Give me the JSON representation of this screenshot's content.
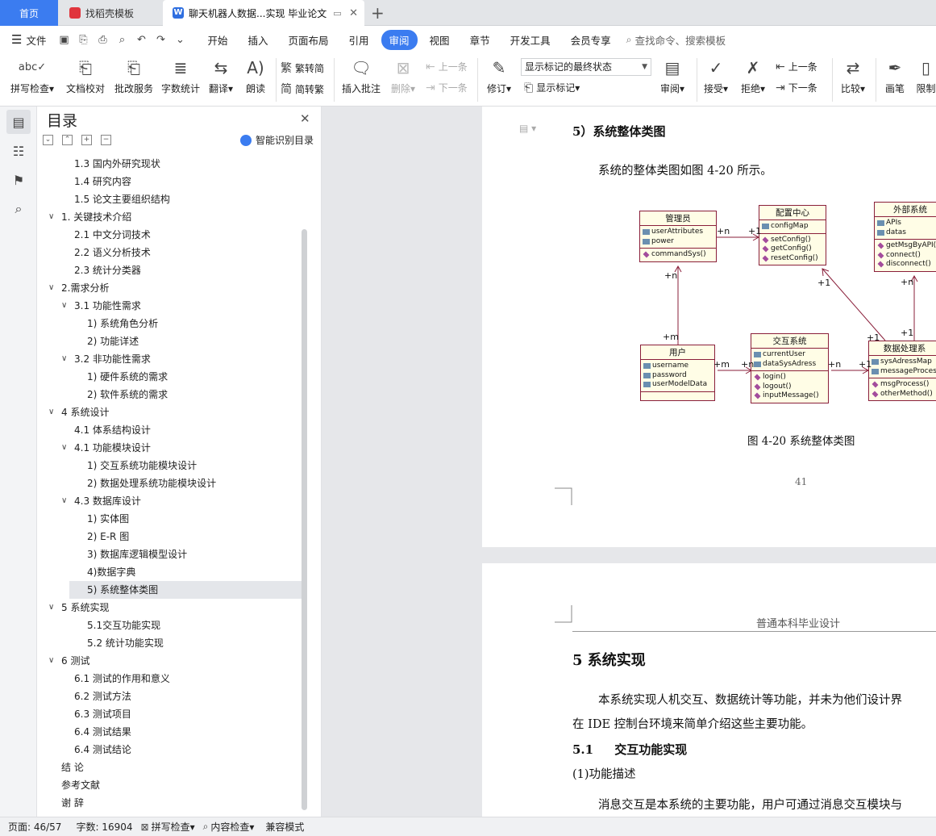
{
  "tabs": {
    "home": "首页",
    "template": "找稻壳模板",
    "document": "聊天机器人数据...实现 毕业论文"
  },
  "menubar": {
    "file": "文件",
    "items": [
      "开始",
      "插入",
      "页面布局",
      "引用",
      "审阅",
      "视图",
      "章节",
      "开发工具",
      "会员专享"
    ],
    "active": "审阅",
    "search": "查找命令、搜索模板"
  },
  "ribbon": {
    "spellcheck": "拼写检查",
    "doc_proof": "文档校对",
    "correction": "批改服务",
    "wordcount": "字数统计",
    "translate": "翻译",
    "read_aloud": "朗读",
    "trad_to_simp": "繁转简",
    "simp_to_trad": "简转繁",
    "insert_comment": "插入批注",
    "delete": "删除",
    "prev_comment": "上一条",
    "next_comment": "下一条",
    "revise": "修订",
    "markup_state": "显示标记的最终状态",
    "show_markup": "显示标记",
    "review": "审阅",
    "accept": "接受",
    "reject": "拒绝",
    "prev_change": "上一条",
    "next_change": "下一条",
    "compare": "比较",
    "pen": "画笔",
    "restrict": "限制"
  },
  "toc": {
    "title": "目录",
    "smart": "智能识别目录",
    "items": [
      {
        "text": "1.3  国内外研究现状",
        "level": 2,
        "arrow": ""
      },
      {
        "text": "1.4  研究内容",
        "level": 2,
        "arrow": ""
      },
      {
        "text": "1.5  论文主要组织结构",
        "level": 2,
        "arrow": ""
      },
      {
        "text": "1.  关键技术介绍",
        "level": 1,
        "arrow": "v"
      },
      {
        "text": "2.1  中文分词技术",
        "level": 2,
        "arrow": ""
      },
      {
        "text": "2.2  语义分析技术",
        "level": 2,
        "arrow": ""
      },
      {
        "text": "2.3  统计分类器",
        "level": 2,
        "arrow": ""
      },
      {
        "text": "2.需求分析",
        "level": 1,
        "arrow": "v"
      },
      {
        "text": "3.1  功能性需求",
        "level": 2,
        "arrow": "v"
      },
      {
        "text": "1)  系统角色分析",
        "level": 3,
        "arrow": ""
      },
      {
        "text": "2)  功能详述",
        "level": 3,
        "arrow": ""
      },
      {
        "text": "3.2  非功能性需求",
        "level": 2,
        "arrow": "v"
      },
      {
        "text": "1)  硬件系统的需求",
        "level": 3,
        "arrow": ""
      },
      {
        "text": "2)  软件系统的需求",
        "level": 3,
        "arrow": ""
      },
      {
        "text": "4  系统设计",
        "level": 1,
        "arrow": "v"
      },
      {
        "text": "4.1  体系结构设计",
        "level": 2,
        "arrow": ""
      },
      {
        "text": "4.1  功能模块设计",
        "level": 2,
        "arrow": "v"
      },
      {
        "text": "1)  交互系统功能模块设计",
        "level": 3,
        "arrow": ""
      },
      {
        "text": "2)  数据处理系统功能模块设计",
        "level": 3,
        "arrow": ""
      },
      {
        "text": "4.3  数据库设计",
        "level": 2,
        "arrow": "v"
      },
      {
        "text": "1)  实体图",
        "level": 3,
        "arrow": ""
      },
      {
        "text": "2)    E-R 图",
        "level": 3,
        "arrow": ""
      },
      {
        "text": "3)  数据库逻辑模型设计",
        "level": 3,
        "arrow": ""
      },
      {
        "text": "4)数据字典",
        "level": 3,
        "arrow": ""
      },
      {
        "text": "5)  系统整体类图",
        "level": 3,
        "arrow": "",
        "selected": true
      },
      {
        "text": "5  系统实现",
        "level": 1,
        "arrow": "v"
      },
      {
        "text": "5.1交互功能实现",
        "level": 3,
        "arrow": ""
      },
      {
        "text": "5.2  统计功能实现",
        "level": 3,
        "arrow": ""
      },
      {
        "text": "6  测试",
        "level": 1,
        "arrow": "v"
      },
      {
        "text": "6.1  测试的作用和意义",
        "level": 2,
        "arrow": ""
      },
      {
        "text": "6.2  测试方法",
        "level": 2,
        "arrow": ""
      },
      {
        "text": "6.3  测试项目",
        "level": 2,
        "arrow": ""
      },
      {
        "text": "6.4  测试结果",
        "level": 2,
        "arrow": ""
      },
      {
        "text": "6.4  测试结论",
        "level": 2,
        "arrow": ""
      },
      {
        "text": "结    论",
        "level": 1,
        "arrow": ""
      },
      {
        "text": "参考文献",
        "level": 1,
        "arrow": ""
      },
      {
        "text": "谢    辞",
        "level": 1,
        "arrow": ""
      }
    ]
  },
  "page1": {
    "heading": "5）系统整体类图",
    "para": "系统的整体类图如图 4-20 所示。",
    "caption": "图 4-20 系统整体类图",
    "page_number": "41"
  },
  "uml": {
    "classes": [
      {
        "id": "admin",
        "name": "管理员",
        "attrs": [
          "userAttributes",
          "power"
        ],
        "ops": [
          "commandSys()"
        ]
      },
      {
        "id": "config",
        "name": "配置中心",
        "attrs": [
          "configMap"
        ],
        "ops": [
          "setConfig()",
          "getConfig()",
          "resetConfig()"
        ]
      },
      {
        "id": "external",
        "name": "外部系统",
        "attrs": [
          "APIs",
          "datas"
        ],
        "ops": [
          "getMsgByAPI(",
          "connect()",
          "disconnect()"
        ]
      },
      {
        "id": "user",
        "name": "用户",
        "attrs": [
          "username",
          "password",
          "userModelData"
        ],
        "ops": []
      },
      {
        "id": "interact",
        "name": "交互系统",
        "attrs": [
          "currentUser",
          "dataSysAdress"
        ],
        "ops": [
          "login()",
          "logout()",
          "inputMessage()"
        ]
      },
      {
        "id": "dataproc",
        "name": "数据处理系",
        "attrs": [
          "sysAdressMap",
          "messageProces"
        ],
        "ops": [
          "msgProcess()",
          "otherMethod()"
        ]
      }
    ],
    "multiplicities": {
      "admin_config_left": "+n",
      "admin_config_right": "+1",
      "admin_bottom": "+n",
      "user_top": "+m",
      "user_interact_left": "+m",
      "user_interact_right": "+n",
      "interact_dp_left": "+n",
      "interact_dp_right": "+1",
      "config_bottom": "+1",
      "dp_config": "+1",
      "dp_top": "+1",
      "external_bottom": "+n"
    }
  },
  "page2": {
    "header": "普通本科毕业设计",
    "chapter": "5  系统实现",
    "para1_line1": "本系统实现人机交互、数据统计等功能，并未为他们设计界",
    "para1_line2": "在 IDE 控制台环境来简单介绍这些主要功能。",
    "section": "5.1     交互功能实现",
    "sub": "(1)功能描述",
    "para2": "消息交互是本系统的主要功能，用户可通过消息交互模块与"
  },
  "statusbar": {
    "page": "页面: 46/57",
    "words": "字数: 16904",
    "spell": "拼写检查",
    "content": "内容检查",
    "mode": "兼容模式"
  }
}
